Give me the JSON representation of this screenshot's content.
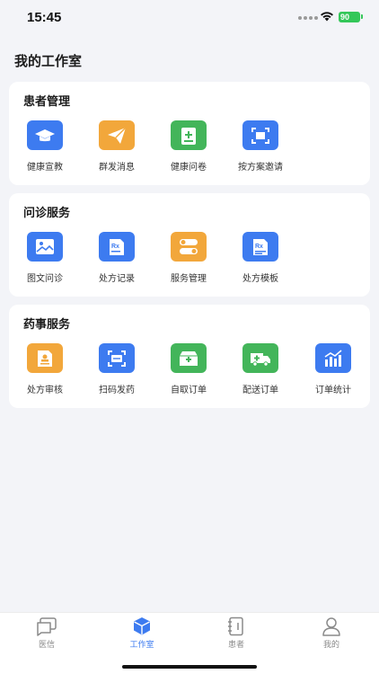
{
  "status": {
    "time": "15:45",
    "battery": "90"
  },
  "page": {
    "title": "我的工作室"
  },
  "sections": [
    {
      "title": "患者管理",
      "items": [
        {
          "label": "健康宣教",
          "icon": "graduation-cap-icon",
          "color": "#3D7BF0"
        },
        {
          "label": "群发消息",
          "icon": "paper-plane-icon",
          "color": "#F2A73B"
        },
        {
          "label": "健康问卷",
          "icon": "clipboard-plus-icon",
          "color": "#43B55A"
        },
        {
          "label": "按方案邀请",
          "icon": "scan-frame-icon",
          "color": "#3D7BF0"
        }
      ]
    },
    {
      "title": "问诊服务",
      "items": [
        {
          "label": "图文问诊",
          "icon": "image-chat-icon",
          "color": "#3D7BF0"
        },
        {
          "label": "处方记录",
          "icon": "rx-document-icon",
          "color": "#3D7BF0"
        },
        {
          "label": "服务管理",
          "icon": "toggle-icon",
          "color": "#F2A73B"
        },
        {
          "label": "处方模板",
          "icon": "rx-template-icon",
          "color": "#3D7BF0"
        }
      ]
    },
    {
      "title": "药事服务",
      "items": [
        {
          "label": "处方审核",
          "icon": "stamp-document-icon",
          "color": "#F2A73B"
        },
        {
          "label": "扫码发药",
          "icon": "scan-code-icon",
          "color": "#3D7BF0"
        },
        {
          "label": "自取订单",
          "icon": "pickup-box-icon",
          "color": "#43B55A"
        },
        {
          "label": "配送订单",
          "icon": "ambulance-truck-icon",
          "color": "#43B55A"
        },
        {
          "label": "订单统计",
          "icon": "bar-chart-icon",
          "color": "#3D7BF0"
        }
      ]
    }
  ],
  "tabs": [
    {
      "label": "医信",
      "icon": "chat-bubbles-icon",
      "active": false
    },
    {
      "label": "工作室",
      "icon": "cube-icon",
      "active": true
    },
    {
      "label": "患者",
      "icon": "address-book-icon",
      "active": false
    },
    {
      "label": "我的",
      "icon": "person-icon",
      "active": false
    }
  ]
}
